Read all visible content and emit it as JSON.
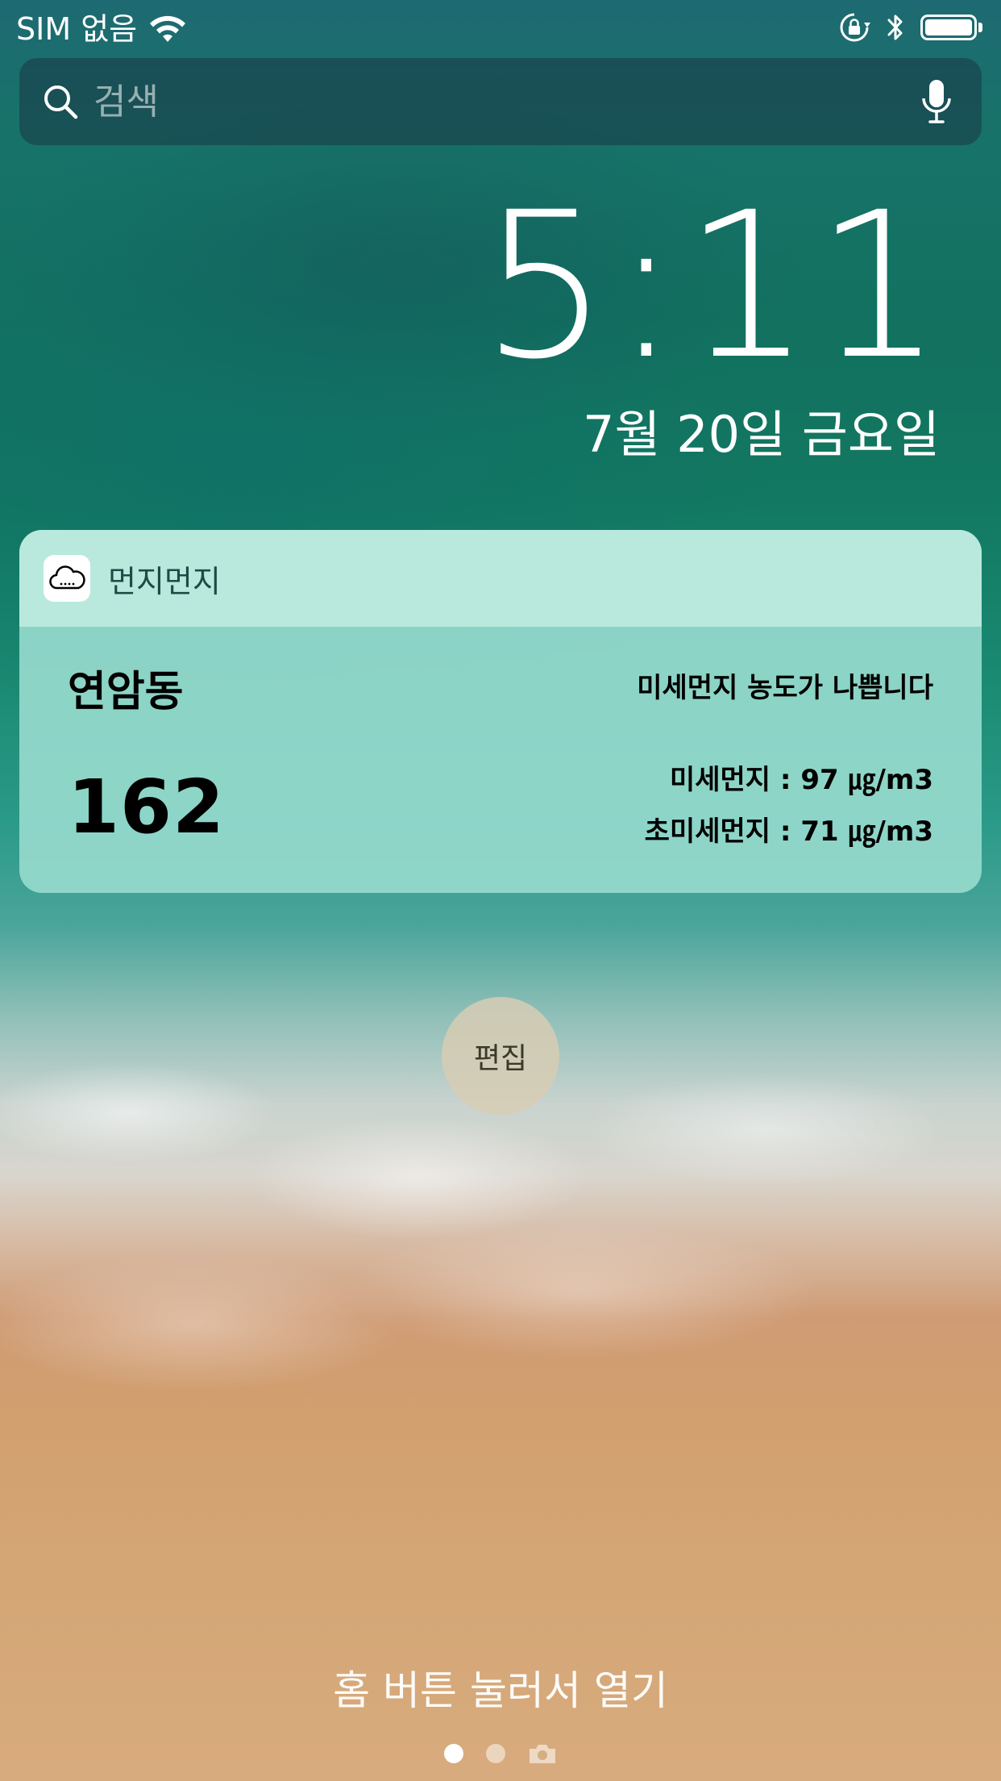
{
  "status_bar": {
    "carrier": "SIM 없음",
    "icons": [
      "wifi-icon",
      "orientation-lock-icon",
      "bluetooth-icon",
      "battery-icon"
    ]
  },
  "search": {
    "placeholder": "검색",
    "icon": "search-icon",
    "mic_icon": "microphone-icon"
  },
  "clock": {
    "time": "5:11",
    "date": "7월 20일 금요일"
  },
  "widget": {
    "app_name": "먼지먼지",
    "app_icon": "cloud-icon",
    "location": "연암동",
    "aqi_value": "162",
    "status_message": "미세먼지 농도가 나쁩니다",
    "pm10": "미세먼지 : 97 ㎍/m3",
    "pm25": "초미세먼지 : 71 ㎍/m3"
  },
  "edit_button": {
    "label": "편집"
  },
  "bottom": {
    "unlock_hint": "홈 버튼 눌러서 열기",
    "page_count": 2,
    "active_page": 0
  },
  "colors": {
    "widget_bg": "#96dacd",
    "widget_header": "#beebde",
    "edit_button_bg": "#d7cdb4"
  }
}
